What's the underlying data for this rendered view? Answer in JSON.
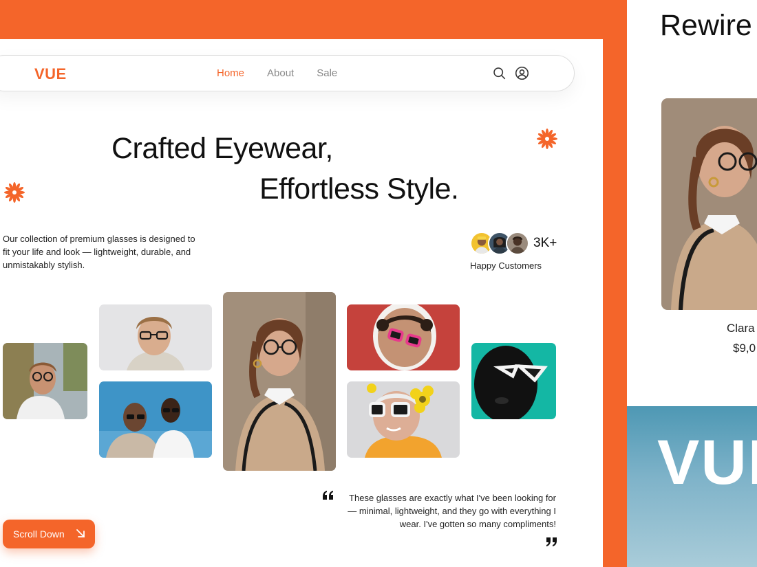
{
  "colors": {
    "accent": "#F4652A",
    "text": "#111111",
    "muted": "#888888"
  },
  "nav": {
    "logo": "VUE",
    "links": [
      {
        "label": "Home",
        "active": true
      },
      {
        "label": "About",
        "active": false
      },
      {
        "label": "Sale",
        "active": false
      }
    ],
    "icons": [
      "search-icon",
      "user-icon"
    ]
  },
  "hero": {
    "line1": "Crafted Eyewear,",
    "line2": "Effortless Style.",
    "description": "Our collection of premium glasses is designed to fit your life and look — lightweight, durable, and unmistakably stylish."
  },
  "customers": {
    "count": "3K+",
    "label": "Happy Customers"
  },
  "testimonial": {
    "text": "These glasses are exactly what I've been looking for — minimal, lightweight, and they go with everything I wear. I've gotten so many compliments!"
  },
  "cta": {
    "label": "Scroll Down",
    "icon": "arrow-down-right-icon"
  },
  "side_panel": {
    "title": "Rewire",
    "product_name": "Clara",
    "product_price": "$9,0",
    "brand": "VUE"
  }
}
